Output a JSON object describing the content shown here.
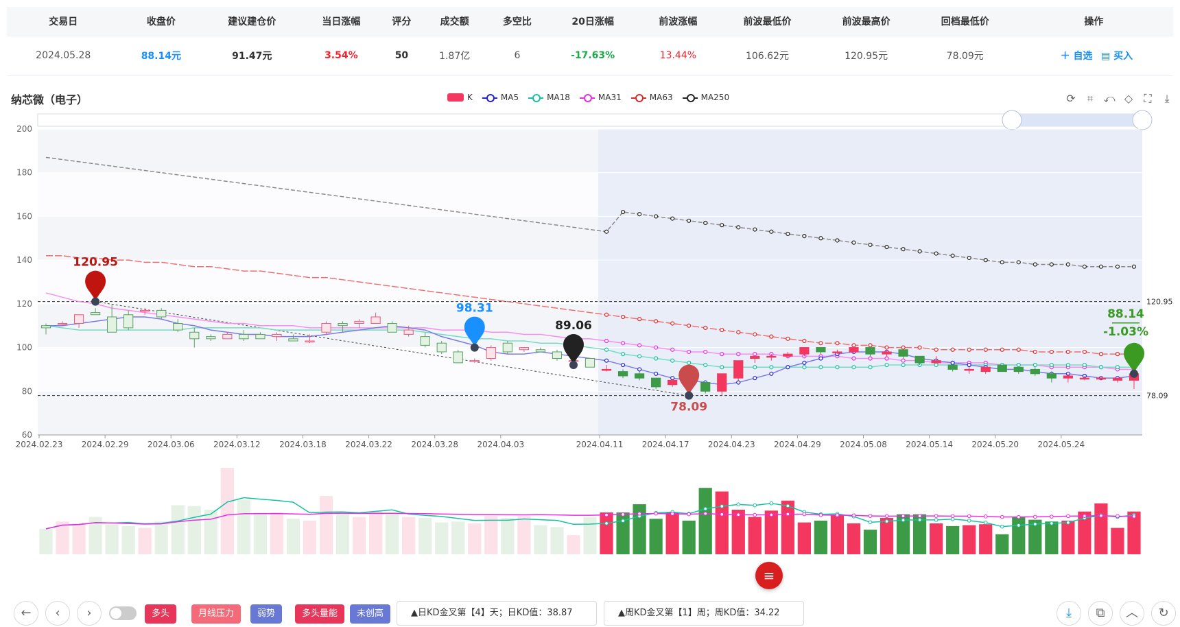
{
  "table": {
    "headers": [
      "交易日",
      "收盘价",
      "建议建仓价",
      "当日涨幅",
      "评分",
      "成交额",
      "多空比",
      "20日涨幅",
      "前波涨幅",
      "前波最低价",
      "前波最高价",
      "回档最低价",
      "操作"
    ],
    "row": {
      "trade_date": "2024.05.28",
      "close": "88.14元",
      "suggest_price": "91.47元",
      "day_change": "3.54%",
      "score": "50",
      "amount": "1.87亿",
      "long_short": "6",
      "change20": "-17.63%",
      "prev_wave_change": "13.44%",
      "prev_wave_low": "106.62元",
      "prev_wave_high": "120.95元",
      "pullback_low": "78.09元",
      "action_add": "＋ 自选",
      "action_buy": "▤ 买入"
    }
  },
  "chart_title": "纳芯微（电子）",
  "legend": [
    {
      "name": "K",
      "color": "#f3375f"
    },
    {
      "name": "MA5",
      "color": "#2323d8"
    },
    {
      "name": "MA18",
      "color": "#16c2a0"
    },
    {
      "name": "MA31",
      "color": "#e92ce6"
    },
    {
      "name": "MA63",
      "color": "#dc2b2b"
    },
    {
      "name": "MA250",
      "color": "#222222"
    }
  ],
  "toolbar_icons": [
    "refresh-icon",
    "zoom-area-icon",
    "zoom-reset-icon",
    "restore-icon",
    "fullscreen-icon",
    "download-icon"
  ],
  "chart_data": {
    "type": "candlestick",
    "ylim": [
      60,
      200
    ],
    "yticks": [
      "200",
      "180",
      "160",
      "140",
      "120",
      "100",
      "80",
      "60"
    ],
    "xticks": [
      "2024.02.23",
      "2024.02.29",
      "2024.03.06",
      "2024.03.12",
      "2024.03.18",
      "2024.03.22",
      "2024.03.28",
      "2024.04.03",
      "2024.04.11",
      "2024.04.17",
      "2024.04.23",
      "2024.04.29",
      "2024.05.08",
      "2024.05.14",
      "2024.05.20",
      "2024.05.24"
    ],
    "candles": [
      [
        110,
        109,
        111,
        106
      ],
      [
        111,
        111,
        112,
        110
      ],
      [
        111,
        115,
        115,
        109
      ],
      [
        116,
        115,
        118,
        115
      ],
      [
        114,
        107,
        120,
        107
      ],
      [
        115,
        109,
        117,
        108
      ],
      [
        117,
        117,
        118,
        115
      ],
      [
        117,
        114,
        118,
        113
      ],
      [
        111,
        108,
        113,
        107
      ],
      [
        107,
        104,
        109,
        100
      ],
      [
        105,
        104,
        106,
        103
      ],
      [
        104,
        106,
        107,
        104
      ],
      [
        106,
        104,
        108,
        103
      ],
      [
        106,
        104,
        107,
        104
      ],
      [
        105,
        106,
        107,
        103
      ],
      [
        104,
        103,
        106,
        103
      ],
      [
        103,
        103,
        106,
        102
      ],
      [
        107,
        111,
        112,
        106
      ],
      [
        111,
        110,
        112,
        107
      ],
      [
        111,
        112,
        113,
        109
      ],
      [
        111,
        114,
        116,
        111
      ],
      [
        111,
        107,
        112,
        107
      ],
      [
        106,
        108,
        110,
        105
      ],
      [
        105,
        101,
        107,
        100
      ],
      [
        102,
        98,
        103,
        97
      ],
      [
        98,
        93,
        99,
        93
      ],
      [
        94,
        94,
        95,
        93
      ],
      [
        95,
        100,
        101,
        94
      ],
      [
        102,
        98,
        103,
        97
      ],
      [
        99,
        100,
        100,
        98
      ],
      [
        99,
        98,
        100,
        98
      ],
      [
        98,
        95,
        99,
        94
      ],
      [
        94,
        94,
        96,
        93
      ],
      [
        95,
        91,
        95,
        91
      ],
      [
        90,
        90,
        92,
        89
      ],
      [
        89,
        87,
        90,
        86
      ],
      [
        88,
        86,
        89,
        85
      ],
      [
        86,
        82,
        86,
        81
      ],
      [
        83,
        85,
        85,
        82
      ],
      [
        87,
        82,
        87,
        82
      ],
      [
        84,
        80,
        84,
        79
      ],
      [
        80,
        88,
        88,
        78
      ],
      [
        86,
        94,
        94,
        85
      ],
      [
        95,
        96,
        96,
        93
      ],
      [
        96,
        96,
        97,
        94
      ],
      [
        96,
        97,
        98,
        95
      ],
      [
        97,
        100,
        100,
        96
      ],
      [
        100,
        98,
        100,
        97
      ],
      [
        98,
        98,
        99,
        97
      ],
      [
        98,
        100,
        100,
        97
      ],
      [
        100,
        97,
        100,
        96
      ],
      [
        97,
        98,
        99,
        96
      ],
      [
        99,
        96,
        99,
        95
      ],
      [
        96,
        93,
        96,
        92
      ],
      [
        93,
        94,
        96,
        93
      ],
      [
        92,
        90,
        92,
        89
      ],
      [
        90,
        90,
        91,
        88
      ],
      [
        89,
        91,
        91,
        88
      ],
      [
        92,
        89,
        92,
        89
      ],
      [
        91,
        89,
        91,
        88
      ],
      [
        90,
        88,
        91,
        87
      ],
      [
        88,
        86,
        89,
        84
      ],
      [
        86,
        87,
        88,
        84
      ],
      [
        86,
        86,
        87,
        85
      ],
      [
        86,
        86,
        87,
        85
      ],
      [
        85,
        86,
        86,
        84
      ],
      [
        85,
        88,
        89,
        81
      ]
    ],
    "ma5": [
      110,
      110,
      111,
      112,
      113,
      114,
      114,
      113,
      111,
      110,
      108,
      107,
      106,
      106,
      105,
      105,
      105,
      106,
      107,
      108,
      109,
      110,
      109,
      108,
      105,
      103,
      101,
      98,
      97,
      97,
      98,
      97,
      96,
      95,
      94,
      92,
      90,
      88,
      86,
      85,
      84,
      83,
      84,
      86,
      88,
      91,
      93,
      95,
      97,
      98,
      98,
      98,
      97,
      95,
      94,
      93,
      92,
      91,
      90,
      90,
      89,
      88,
      88,
      87,
      86,
      86,
      87
    ],
    "ma18": [
      110,
      109,
      108,
      108,
      108,
      108,
      108,
      108,
      108,
      109,
      109,
      109,
      109,
      109,
      108,
      108,
      108,
      108,
      108,
      108,
      108,
      108,
      108,
      107,
      106,
      105,
      104,
      104,
      103,
      103,
      102,
      102,
      101,
      100,
      99,
      97,
      96,
      95,
      94,
      93,
      92,
      91,
      91,
      91,
      91,
      91,
      91,
      91,
      91,
      91,
      91,
      92,
      92,
      92,
      92,
      92,
      92,
      92,
      92,
      92,
      92,
      92,
      92,
      92,
      91,
      91,
      91
    ],
    "ma31": [
      125,
      123,
      121,
      120,
      118,
      117,
      116,
      115,
      114,
      113,
      112,
      111,
      111,
      110,
      110,
      110,
      109,
      109,
      109,
      109,
      109,
      109,
      109,
      109,
      108,
      108,
      108,
      107,
      107,
      106,
      106,
      105,
      104,
      104,
      103,
      102,
      101,
      100,
      99,
      98,
      98,
      97,
      97,
      97,
      97,
      96,
      96,
      96,
      96,
      95,
      95,
      95,
      94,
      94,
      93,
      93,
      93,
      93,
      92,
      92,
      92,
      91,
      91,
      91,
      91,
      90,
      90
    ],
    "ma63": [
      142,
      142,
      141,
      141,
      140,
      140,
      139,
      139,
      138,
      137,
      137,
      136,
      135,
      135,
      134,
      133,
      132,
      132,
      131,
      130,
      129,
      128,
      127,
      126,
      125,
      124,
      123,
      122,
      121,
      120,
      119,
      118,
      117,
      116,
      115,
      114,
      113,
      112,
      111,
      110,
      109,
      108,
      107,
      106,
      105,
      104,
      103,
      102,
      102,
      101,
      101,
      100,
      100,
      100,
      99,
      99,
      99,
      99,
      99,
      99,
      98,
      98,
      98,
      98,
      97,
      97,
      97
    ],
    "ma250": [
      187,
      186,
      185,
      184,
      183,
      182,
      181,
      180,
      179,
      178,
      177,
      176,
      175,
      174,
      173,
      172,
      171,
      170,
      169,
      168,
      167,
      166,
      165,
      164,
      163,
      162,
      161,
      160,
      159,
      158,
      157,
      156,
      155,
      154,
      153,
      162,
      161,
      160,
      159,
      158,
      157,
      156,
      155,
      154,
      153,
      152,
      151,
      150,
      149,
      148,
      147,
      146,
      145,
      144,
      143,
      142,
      141,
      140,
      139,
      139,
      138,
      138,
      138,
      137,
      137,
      137,
      137
    ],
    "markers": [
      {
        "label": "120.95",
        "index": 3,
        "value": 121,
        "color": "#c0140f"
      },
      {
        "label": "98.31",
        "index": 26,
        "value": 100,
        "color": "#1890ff"
      },
      {
        "label": "89.06",
        "index": 32,
        "value": 92,
        "color": "#222222"
      },
      {
        "label": "78.09",
        "index": 39,
        "value": 78,
        "color": "#c94b4b"
      },
      {
        "label": "88.14",
        "label2": "-1.03%",
        "index": 66,
        "value": 88,
        "color": "#3a9a21"
      }
    ],
    "hlines": [
      {
        "label": "120.95",
        "value": 121
      },
      {
        "label": "78.09",
        "value": 78
      }
    ],
    "volume": [
      0.28,
      0.36,
      0.34,
      0.41,
      0.33,
      0.31,
      0.29,
      0.36,
      0.54,
      0.53,
      0.49,
      0.95,
      0.6,
      0.46,
      0.46,
      0.39,
      0.37,
      0.64,
      0.47,
      0.41,
      0.47,
      0.45,
      0.41,
      0.4,
      0.35,
      0.36,
      0.34,
      0.42,
      0.4,
      0.42,
      0.32,
      0.3,
      0.21,
      0.41,
      0.46,
      0.46,
      0.55,
      0.39,
      0.46,
      0.37,
      0.73,
      0.69,
      0.49,
      0.41,
      0.48,
      0.59,
      0.35,
      0.37,
      0.43,
      0.34,
      0.27,
      0.4,
      0.44,
      0.44,
      0.34,
      0.31,
      0.32,
      0.33,
      0.22,
      0.41,
      0.38,
      0.36,
      0.37,
      0.47,
      0.56,
      0.29,
      0.47
    ]
  },
  "float_menu_icon": "menu-icon",
  "bottom": {
    "nav_icons": [
      "arrow-left-icon",
      "chevron-left-icon",
      "chevron-right-icon"
    ],
    "tags": [
      {
        "label": "多头",
        "color": "#e8365a"
      },
      {
        "label": "月线压力",
        "color": "#f56a78"
      },
      {
        "label": "弱势",
        "color": "#6779d4"
      },
      {
        "label": "多头量能",
        "color": "#e8365a"
      },
      {
        "label": "未创高",
        "color": "#6779d4"
      }
    ],
    "info1": "▲日KD金叉第【4】天；日KD值：38.87",
    "info2": "▲周KD金叉第【1】周；周KD值：34.22",
    "right_icons": [
      "download-icon",
      "copy-icon",
      "up-icon",
      "refresh-icon"
    ]
  }
}
